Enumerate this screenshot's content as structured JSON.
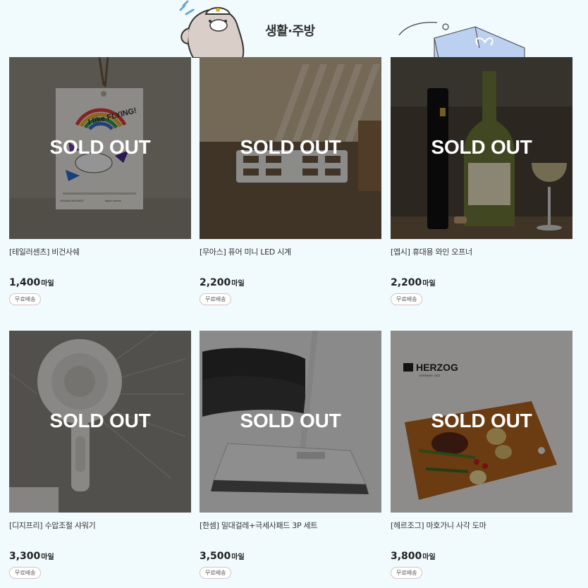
{
  "section": {
    "title": "생활·주방"
  },
  "colors": {
    "background": "#f1fafd",
    "overlay": "rgba(0,0,0,0.42)",
    "badge_border": "#d8c3c3"
  },
  "products": [
    {
      "name": "[테일러센츠] 비건사쉐",
      "price": "1,400",
      "unit": "마일",
      "badge": "무료배송",
      "status": "SOLD OUT",
      "image": "sachet-tag"
    },
    {
      "name": "[무아스] 퓨어 미니 LED 시계",
      "price": "2,200",
      "unit": "마일",
      "badge": "무료배송",
      "status": "SOLD OUT",
      "image": "led-clock"
    },
    {
      "name": "[엡시] 휴대용 와인 오프너",
      "price": "2,200",
      "unit": "마일",
      "badge": "무료배송",
      "status": "SOLD OUT",
      "image": "wine-opener"
    },
    {
      "name": "[디지프리] 수압조절 샤워기",
      "price": "3,300",
      "unit": "마일",
      "badge": "무료배송",
      "status": "SOLD OUT",
      "image": "shower-head"
    },
    {
      "name": "[한셈] 밀대걸레+극세사패드 3P 세트",
      "price": "3,500",
      "unit": "마일",
      "badge": "무료배송",
      "status": "SOLD OUT",
      "image": "mop-set"
    },
    {
      "name": "[헤르조그] 마호가니 사각 도마",
      "price": "3,800",
      "unit": "마일",
      "badge": "무료배송",
      "status": "SOLD OUT",
      "image": "cutting-board"
    }
  ],
  "photo_text": {
    "tag_slogan": "I like FLYING!",
    "tag_brand_left": "ASIANA AIRLINES",
    "tag_brand_right": "taylor scents",
    "board_brand": "HERZOG",
    "board_sub": "GERMANY 1922"
  }
}
